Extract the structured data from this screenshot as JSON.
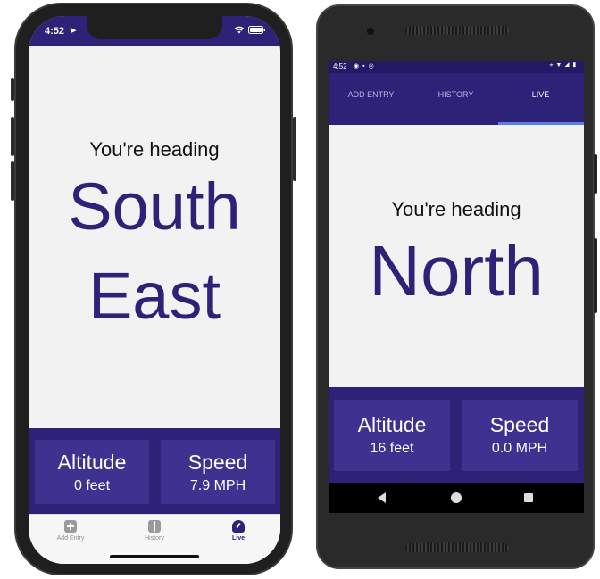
{
  "colors": {
    "primary": "#2e2178",
    "card": "#3f3190",
    "active_tab": "#5a7cf0"
  },
  "ios": {
    "status": {
      "time": "4:52",
      "location_icon": "location-arrow-icon",
      "right_icons": "wifi-icon battery-icon"
    },
    "heading_label": "You're heading",
    "direction_line1": "South",
    "direction_line2": "East",
    "altitude": {
      "title": "Altitude",
      "value": "0 feet"
    },
    "speed": {
      "title": "Speed",
      "value": "7.9 MPH"
    },
    "tabs": [
      {
        "label": "Add Entry",
        "icon": "add-entry-icon"
      },
      {
        "label": "History",
        "icon": "book-icon"
      },
      {
        "label": "Live",
        "icon": "speedometer-icon"
      }
    ]
  },
  "android": {
    "status": {
      "time": "4:52"
    },
    "tabs": [
      {
        "label": "ADD ENTRY"
      },
      {
        "label": "HISTORY"
      },
      {
        "label": "LIVE"
      }
    ],
    "active_tab": "LIVE",
    "heading_label": "You're heading",
    "direction": "North",
    "altitude": {
      "title": "Altitude",
      "value": "16 feet"
    },
    "speed": {
      "title": "Speed",
      "value": "0.0 MPH"
    }
  }
}
